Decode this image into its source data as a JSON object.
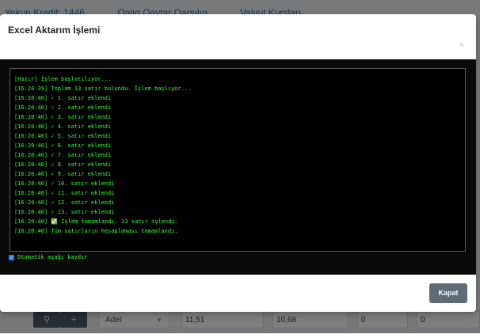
{
  "background": {
    "links": [
      "Yekun Kredit: 1446",
      "Qalıq Qaytar Qarşılıq",
      "Valyut Kursları"
    ],
    "row": {
      "unit": "Adet",
      "price1": "11,51",
      "price2": "10,68",
      "qty1": "0",
      "qty2": "0"
    }
  },
  "modal": {
    "title": "Excel Aktarım İşlemi",
    "close_symbol": "×",
    "console_lines": [
      "[Hazır] İşlem başlatılıyor...",
      "[16:20:39] Toplam 13 satır bulundu. İşlem başlıyor...",
      "[16:20:40] ✓ 1. satır eklendi",
      "[16:20:40] ✓ 2. satır eklendi",
      "[16:20:40] ✓ 3. satır eklendi",
      "[16:20:40] ✓ 4. satır eklendi",
      "[16:20:40] ✓ 5. satır eklendi",
      "[16:20:40] ✓ 6. satır eklendi",
      "[16:20:40] ✓ 7. satır eklendi",
      "[16:20:40] ✓ 8. satır eklendi",
      "[16:20:40] ✓ 9. satır eklendi",
      "[16:20:40] ✓ 10. satır eklendi",
      "[16:20:40] ✓ 11. satır eklendi",
      "[16:20:40] ✓ 12. satır eklendi",
      "[16:20:40] ✓ 13. satır eklendi",
      "[16:20:40] ✅ İşlem tamamlandı. 13 satır işlendi.",
      "[16:20:40] Tüm satırların hesaplaması tamamlandı."
    ],
    "autosave_label": "Otomatik aşağı kaydır",
    "autosave_checked": true,
    "close_button": "Kapat"
  }
}
